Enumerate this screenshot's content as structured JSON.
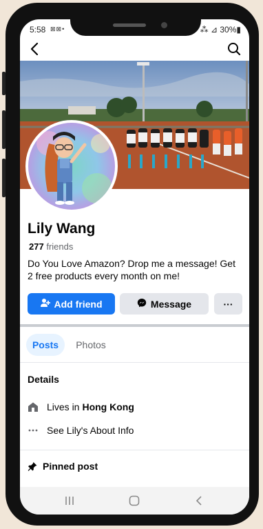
{
  "status": {
    "time": "5:58",
    "notif_icons": "⊠⊠•",
    "right": "⁂ ⊿ 30%▮"
  },
  "profile": {
    "name": "Lily Wang",
    "friends_count": "277",
    "friends_label": "friends",
    "bio": "Do You Love Amazon? Drop me a message! Get 2 free products every month on me!"
  },
  "actions": {
    "add_friend": "Add friend",
    "message": "Message",
    "more": "···"
  },
  "tabs": [
    {
      "label": "Posts",
      "active": true
    },
    {
      "label": "Photos",
      "active": false
    }
  ],
  "details": {
    "title": "Details",
    "lives_prefix": "Lives in",
    "lives_city": "Hong Kong",
    "about": "See Lily's About Info"
  },
  "pinned": {
    "title": "Pinned post"
  },
  "colors": {
    "accent": "#1877f2",
    "button_gray": "#e4e6eb",
    "text": "#050505",
    "muted": "#65676b"
  },
  "icons": {
    "back": "back-arrow-icon",
    "search": "search-icon",
    "add_friend": "add-friend-icon",
    "messenger": "messenger-icon",
    "home": "home-icon",
    "more": "more-dots-icon",
    "pin": "pin-icon"
  }
}
